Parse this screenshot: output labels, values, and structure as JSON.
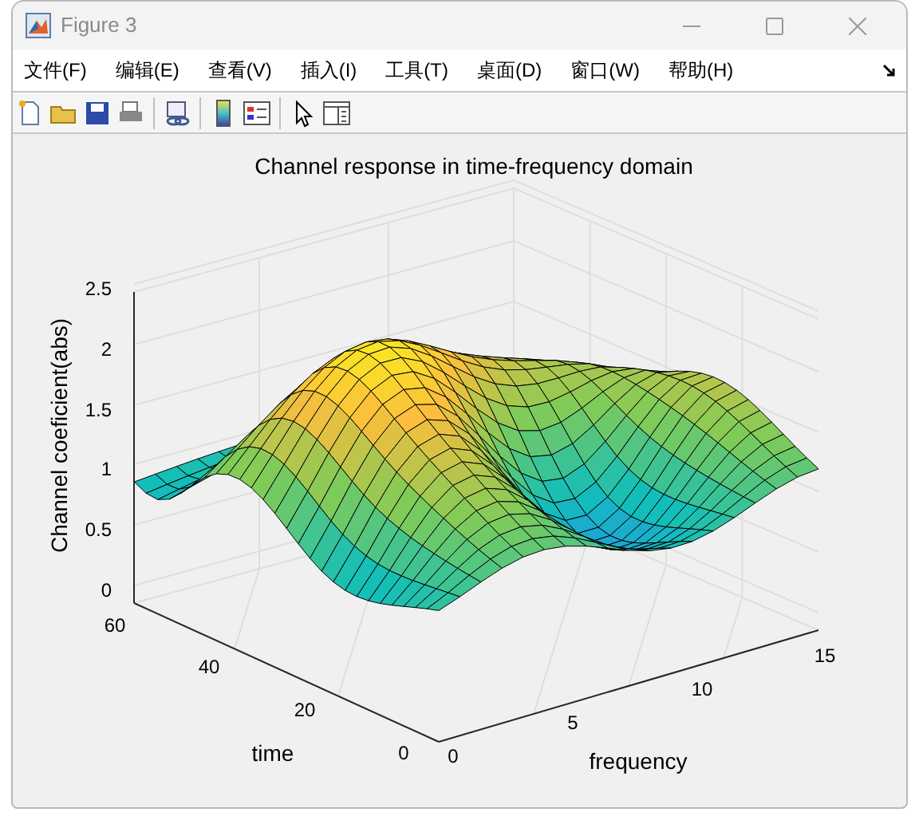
{
  "window": {
    "title": "Figure 3"
  },
  "menu": [
    "文件(F)",
    "编辑(E)",
    "查看(V)",
    "插入(I)",
    "工具(T)",
    "桌面(D)",
    "窗口(W)",
    "帮助(H)"
  ],
  "plot": {
    "title": "Channel response in time-frequency domain",
    "zlabel": "Channel coeficient(abs)",
    "ylabel": "time",
    "xlabel": "frequency",
    "zticks": [
      "2.5",
      "2",
      "1.5",
      "1",
      "0.5",
      "0"
    ],
    "yticks": [
      "60",
      "40",
      "20",
      "0"
    ],
    "xticks": [
      "0",
      "5",
      "10",
      "15"
    ]
  }
}
